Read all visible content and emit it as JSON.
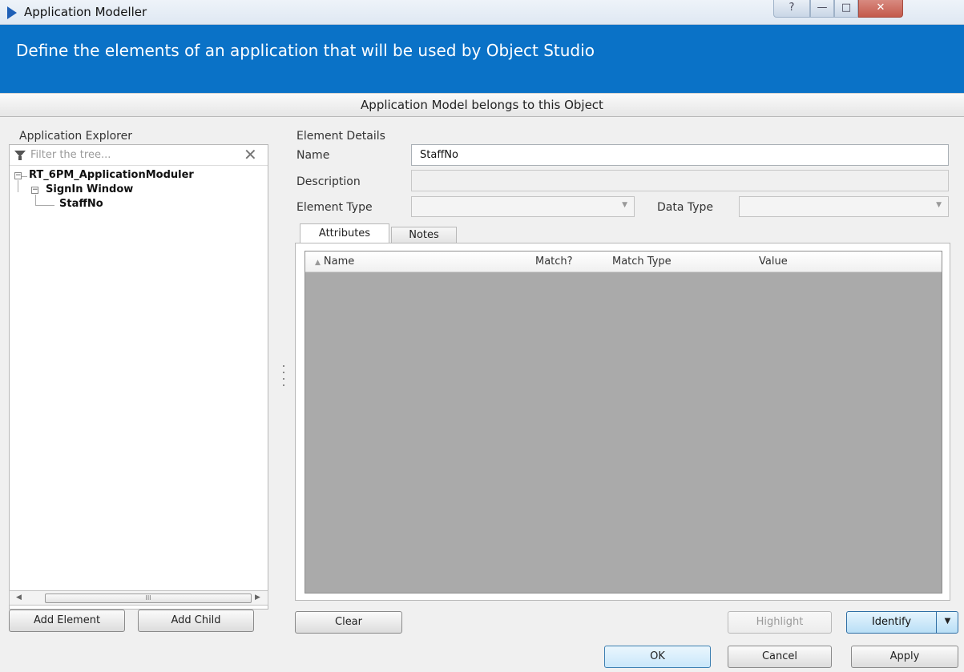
{
  "window": {
    "title": "Application Modeller",
    "help_glyph": "?",
    "min_glyph": "—",
    "max_glyph": "□",
    "close_glyph": "✕"
  },
  "banner": {
    "text": "Define the elements of an application that will be used by Object Studio",
    "color": "#0a72c7"
  },
  "belongs_button": "Application Model belongs to this Object",
  "explorer": {
    "title": "Application Explorer",
    "filter_placeholder": "Filter the tree...",
    "tree": {
      "root": "RT_6PM_ApplicationModuler",
      "child": "SignIn Window",
      "leaf": "StaffNo"
    },
    "scroll_grip": "III",
    "add_element": "Add Element",
    "add_child": "Add Child"
  },
  "details": {
    "title": "Element Details",
    "name_label": "Name",
    "name_value": "StaffNo",
    "description_label": "Description",
    "description_value": "",
    "element_type_label": "Element Type",
    "data_type_label": "Data Type"
  },
  "tabs": [
    "Attributes",
    "Notes"
  ],
  "grid": {
    "columns": [
      "Name",
      "Match?",
      "Match Type",
      "Value"
    ]
  },
  "actions": {
    "clear": "Clear",
    "highlight": "Highlight",
    "identify": "Identify",
    "ok": "OK",
    "cancel": "Cancel",
    "apply": "Apply"
  }
}
